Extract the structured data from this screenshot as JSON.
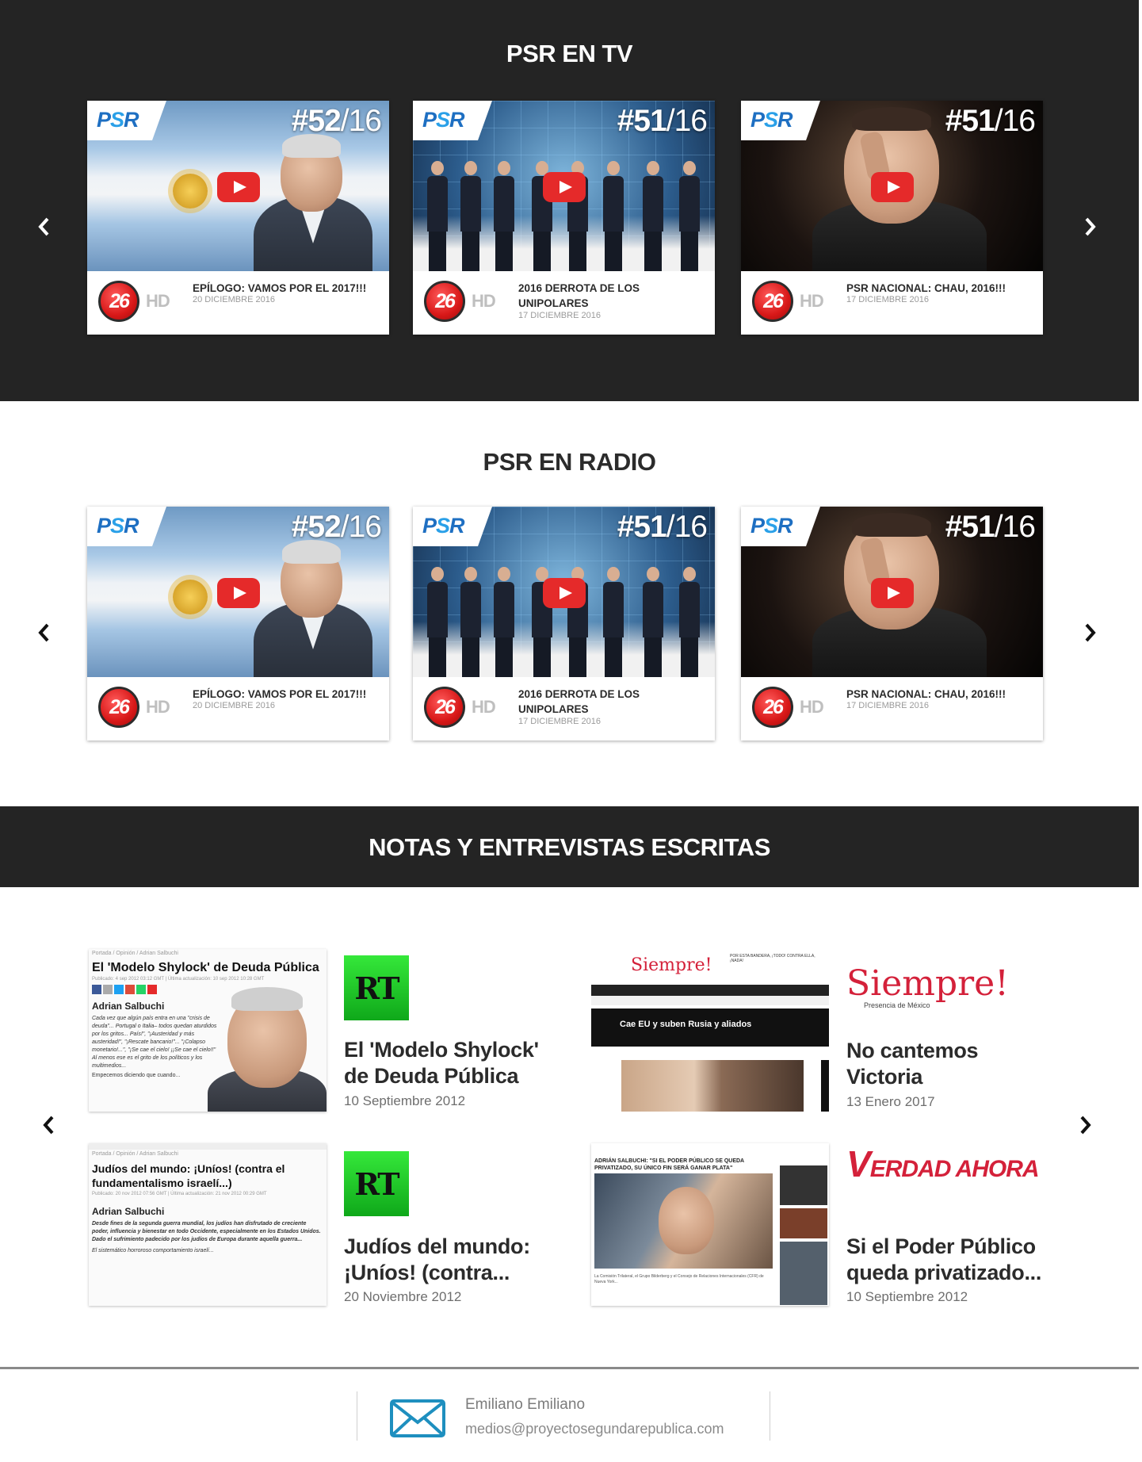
{
  "tv": {
    "title": "PSR EN TV",
    "cards": [
      {
        "ep_num": "#52",
        "ep_year": "/16",
        "channel": "26",
        "hd": "HD",
        "title": "EPÍLOGO: VAMOS POR EL 2017!!!",
        "date": "20 DICIEMBRE 2016"
      },
      {
        "ep_num": "#51",
        "ep_year": "/16",
        "channel": "26",
        "hd": "HD",
        "title": "2016 DERROTA DE LOS UNIPOLARES",
        "date": "17 DICIEMBRE 2016"
      },
      {
        "ep_num": "#51",
        "ep_year": "/16",
        "channel": "26",
        "hd": "HD",
        "title": "PSR NACIONAL: CHAU, 2016!!!",
        "date": "17 DICIEMBRE 2016"
      }
    ]
  },
  "radio": {
    "title": "PSR EN RADIO",
    "cards": [
      {
        "ep_num": "#52",
        "ep_year": "/16",
        "channel": "26",
        "hd": "HD",
        "title": "EPÍLOGO: VAMOS POR EL 2017!!!",
        "date": "20 DICIEMBRE 2016"
      },
      {
        "ep_num": "#51",
        "ep_year": "/16",
        "channel": "26",
        "hd": "HD",
        "title": "2016 DERROTA DE LOS UNIPOLARES",
        "date": "17 DICIEMBRE 2016"
      },
      {
        "ep_num": "#51",
        "ep_year": "/16",
        "channel": "26",
        "hd": "HD",
        "title": "PSR NACIONAL: CHAU, 2016!!!",
        "date": "17 DICIEMBRE 2016"
      }
    ]
  },
  "psr_logo": {
    "p": "P",
    "s": "S",
    "r": "R"
  },
  "notes": {
    "title": "NOTAS Y ENTREVISTAS ESCRITAS",
    "articles": [
      {
        "source": "RT",
        "title": "El 'Modelo Shylock' de Deuda Pública",
        "date": "10 Septiembre 2012",
        "mini": {
          "crumb": "Portada / Opinión / Adrian Salbuchi",
          "headline": "El 'Modelo Shylock' de Deuda Pública",
          "meta": "Publicado: 4 sep 2012 03:12 GMT | Última actualización: 10 sep 2012 10:28 GMT",
          "author": "Adrian Salbuchi",
          "text": "Cada vez que algún país entra en una \"crisis de deuda\"... Portugal o Italia– todos quedan aturdidos por los gritos... País!\", \"¡Austeridad y más austeridad!\", \"¡Rescate bancario!\"... \"¡Colapso monetario!...\", \"¡Se cae el cielo! ¡¡Se cae el cielo!!\" Al menos ese es el grito de los políticos y los multimedios...",
          "more": "Empecemos diciendo que cuando..."
        }
      },
      {
        "source": "Siempre!",
        "source_sub": "Presencia de México",
        "title": "No cantemos Victoria",
        "date": "13  Enero 2017",
        "mini": {
          "logo": "Siempre!",
          "banner": "Cae EU y suben Rusia y aliados",
          "tagline": "POR ESTA BANDERA, ¡TODO! CONTRA ELLA, ¡NADA!"
        }
      },
      {
        "source": "RT",
        "title": "Judíos del mundo: ¡Uníos! (contra...",
        "date": "20 Noviembre 2012",
        "mini": {
          "crumb": "Portada / Opinión / Adrian Salbuchi",
          "headline": "Judíos del mundo: ¡Uníos! (contra el fundamentalismo israelí...)",
          "meta": "Publicado: 20 nov 2012 07:56 GMT | Última actualización: 21 nov 2012 00:29 GMT",
          "author": "Adrian Salbuchi",
          "text": "Desde fines de la segunda guerra mundial, los judíos han disfrutado de creciente poder, influencia y bienestar en todo Occidente, especialmente en los Estados Unidos. Dado el sufrimiento padecido por los judíos de Europa durante aquella guerra...",
          "more": "El sistemático horroroso comportamiento israelí..."
        }
      },
      {
        "source": "VERDAD AHORA",
        "source_v": "V",
        "source_rest": "ERDAD AHORA",
        "title": "Si el Poder Público queda privatizado...",
        "date": "10 Septiembre 2012",
        "mini": {
          "headline": "ADRIÁN SALBUCHI: \"SI EL PODER PÚBLICO SE QUEDA PRIVATIZADO, SU ÚNICO FIN SERÁ GANAR PLATA\"",
          "text": "La Comisión Trilateral, el Grupo Bilderberg y el Consejo de Relaciones Internacionales (CFR) de Nueva York..."
        }
      }
    ]
  },
  "footer": {
    "name": "Emiliano Emiliano",
    "email": "medios@proyectosegundarepublica.com"
  },
  "colors": {
    "dark_band": "#242424",
    "accent_red": "#d4213a",
    "youtube_red": "#e52a2a",
    "mail_blue": "#1e8fbf"
  },
  "icons": [
    "chevron-left-icon",
    "chevron-right-icon",
    "youtube-play-icon",
    "mail-icon"
  ]
}
